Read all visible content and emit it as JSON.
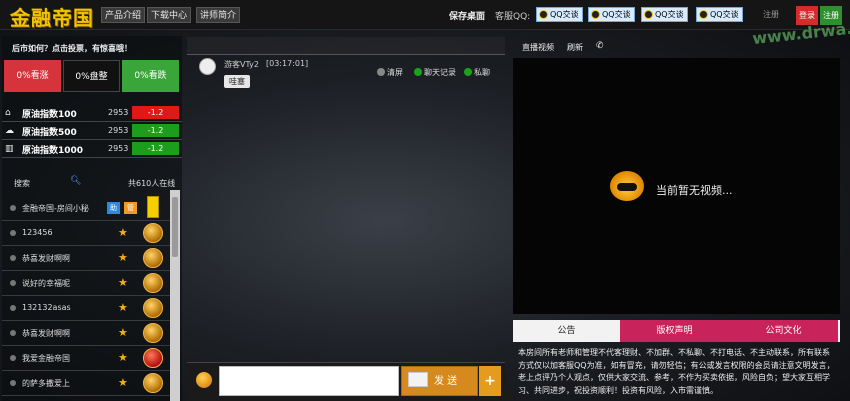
{
  "header": {
    "logo": "金融帝国",
    "nav": [
      "产品介绍",
      "下载中心",
      "讲师简介"
    ],
    "save_desk": "保存桌面",
    "service_label": "客服QQ:",
    "qq_buttons": [
      "QQ交谈",
      "QQ交谈",
      "QQ交谈",
      "QQ交谈"
    ],
    "register_small": "注册",
    "login": "登录",
    "register": "注册",
    "watermark": "www.drwa.com"
  },
  "left": {
    "notice": "后市如何？点击投票，有惊喜哦！",
    "stats": [
      {
        "label": "0%看涨",
        "color": "#d6343c"
      },
      {
        "label": "0%盘整",
        "color": "#111111"
      },
      {
        "label": "0%看跌",
        "color": "#3aa63a"
      }
    ],
    "indices": [
      {
        "icon": "house-icon",
        "name": "原油指数100",
        "value": "2953",
        "change": "-1.2",
        "color": "#e01818"
      },
      {
        "icon": "cloud-icon",
        "name": "原油指数500",
        "value": "2953",
        "change": "-1.2",
        "color": "#1c9e1c"
      },
      {
        "icon": "bars-icon",
        "name": "原油指数1000",
        "value": "2953",
        "change": "-1.2",
        "color": "#1c9e1c"
      }
    ],
    "search_label": "搜索",
    "online": "共610人在线",
    "users": [
      {
        "name": "金融帝国-房间小秘"
      },
      {
        "name": "123456"
      },
      {
        "name": "恭喜发财啊啊"
      },
      {
        "name": "说好的幸福呢"
      },
      {
        "name": "132132asas"
      },
      {
        "name": "恭喜发财啊啊"
      },
      {
        "name": "我爱金融帝国"
      },
      {
        "name": "的萨多撒爱上"
      }
    ]
  },
  "chat": {
    "username": "游客VTy2",
    "time": "[03:17:01]",
    "message": "哇塞",
    "tools": [
      "清屏",
      "聊天记录",
      "私聊"
    ],
    "send": "发 送",
    "plus": "+"
  },
  "right": {
    "live": "直播视频",
    "refresh": "刷新",
    "no_video": "当前暂无视频...",
    "tabs": [
      "公告",
      "版权声明",
      "公司文化"
    ],
    "announcement": "本房间所有老师和管理不代客理财、不加群、不私聊、不打电话、不主动联系，所有联系方式仅以加客服QQ为准，如有冒充，请勿轻信；有公或发言权限的会员请注意文明发言，老上点评乃个人观点，仅供大家交流、参考，不作为买卖依据，风险自负；望大家互相学习、共同进步，祝投资顺利！投资有风险，入市需谨慎。"
  }
}
